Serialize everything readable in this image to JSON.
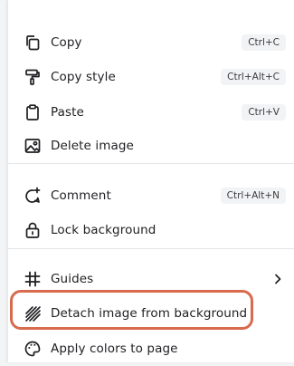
{
  "menu": {
    "items": [
      {
        "label": "Copy",
        "shortcut": "Ctrl+C",
        "icon": "copy-icon"
      },
      {
        "label": "Copy style",
        "shortcut": "Ctrl+Alt+C",
        "icon": "paint-roller-icon"
      },
      {
        "label": "Paste",
        "shortcut": "Ctrl+V",
        "icon": "clipboard-icon"
      },
      {
        "label": "Delete image",
        "icon": "image-icon"
      },
      {
        "label": "Comment",
        "shortcut": "Ctrl+Alt+N",
        "icon": "comment-plus-icon"
      },
      {
        "label": "Lock background",
        "icon": "lock-icon"
      },
      {
        "label": "Guides",
        "icon": "grid-icon"
      },
      {
        "label": "Detach image from background",
        "icon": "detach-icon"
      },
      {
        "label": "Apply colors to page",
        "icon": "palette-icon"
      }
    ]
  },
  "colors": {
    "highlight_outline": "#d86a4e",
    "shortcut_bg": "#f2f3f5"
  }
}
